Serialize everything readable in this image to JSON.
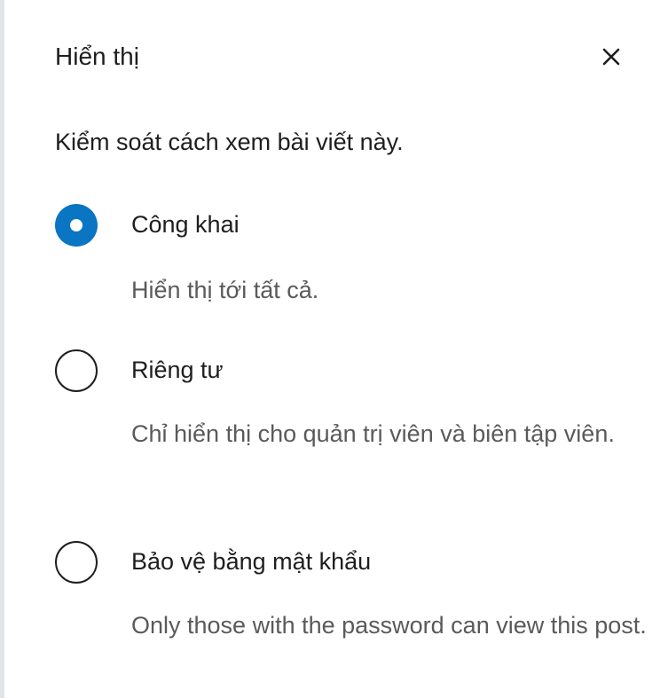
{
  "header": {
    "title": "Hiển thị",
    "close_icon": "close-icon"
  },
  "description": "Kiểm soát cách xem bài viết này.",
  "visibility": {
    "selected": "public",
    "options": [
      {
        "id": "public",
        "label": "Công khai",
        "help": "Hiển thị tới tất cả."
      },
      {
        "id": "private",
        "label": "Riêng tư",
        "help": "Chỉ hiển thị cho quản trị viên và biên tập viên."
      },
      {
        "id": "password",
        "label": "Bảo vệ bằng mật khẩu",
        "help": "Only those with the password can view this post."
      }
    ]
  },
  "colors": {
    "accent": "#0a75c2",
    "text": "#1e1e1e",
    "help_text": "#5a5a5a",
    "border": "#e2e4e7"
  }
}
